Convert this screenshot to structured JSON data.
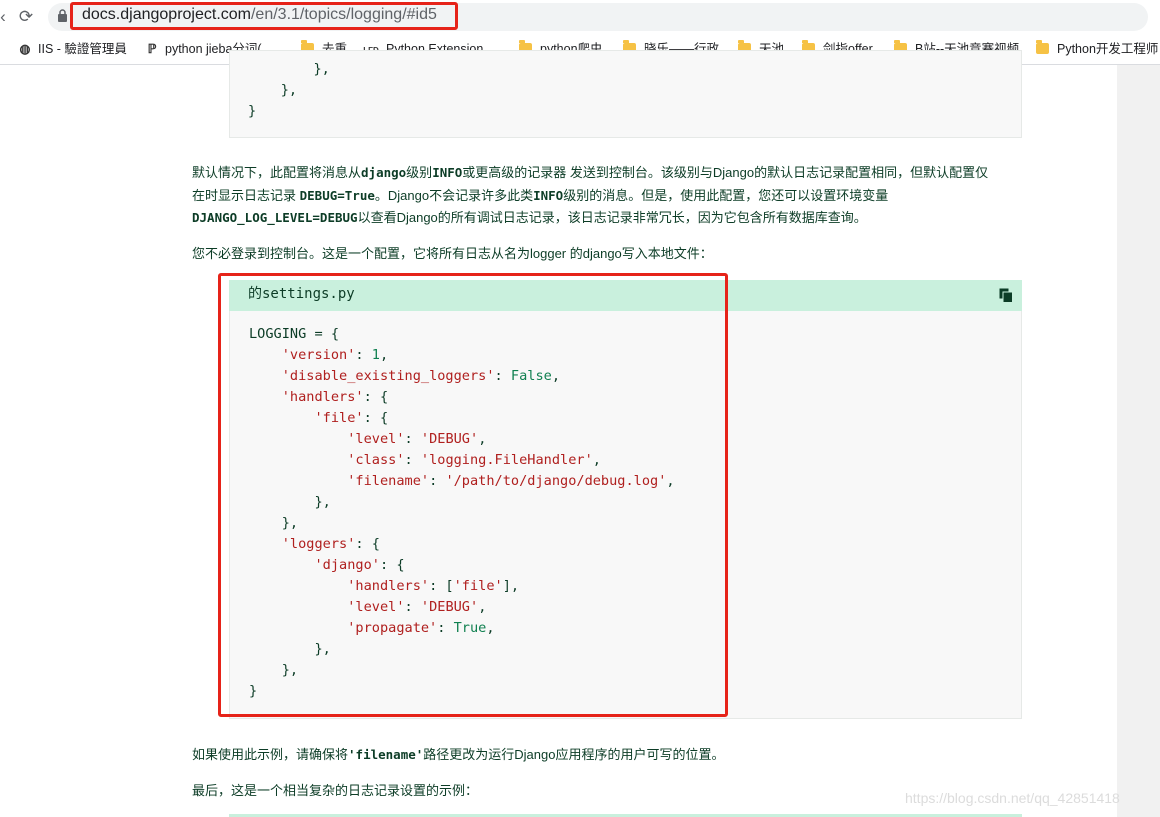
{
  "browser": {
    "url_host": "docs.djangoproject.com",
    "url_path": "/en/3.1/topics/logging/#id5",
    "bookmarks": [
      {
        "icon": "globe-icon",
        "label": "IIS - 驗證管理員"
      },
      {
        "icon": "python-icon",
        "label": "python jieba分词(..."
      },
      {
        "icon": "folder-icon",
        "label": "去重"
      },
      {
        "icon": "lfd-icon",
        "icon_text": "LFD",
        "label": "Python Extension..."
      },
      {
        "icon": "folder-icon",
        "label": "python爬虫"
      },
      {
        "icon": "folder-icon",
        "label": "晓乐——行政"
      },
      {
        "icon": "folder-icon",
        "label": "天池"
      },
      {
        "icon": "folder-icon",
        "label": "剑指offer"
      },
      {
        "icon": "folder-icon",
        "label": "B站--天池竞赛视频"
      },
      {
        "icon": "folder-icon",
        "label": "Python开发工程师"
      }
    ]
  },
  "page": {
    "prev_code_tail": "        },\n    },\n}",
    "para1_line1_a": "默认情况下，此配置将消息从",
    "para1_line1_b": "django",
    "para1_line1_c": "级别",
    "para1_line1_d": "INFO",
    "para1_line1_e": "或更高级的记录器 发送到控制台。该级别与Django的默认日志记录配置相同，但默认配置仅",
    "para1_line2_a": "在时显示日志记录 ",
    "para1_line2_b": "DEBUG=True",
    "para1_line2_c": "。Django不会记录许多此类",
    "para1_line2_d": "INFO",
    "para1_line2_e": "级别的消息。但是，使用此配置，您还可以设置环境变量",
    "para1_line3_a": "DJANGO_LOG_LEVEL=DEBUG",
    "para1_line3_b": "以查看Django的所有调试日志记录，该日志记录非常冗长，因为它包含所有数据库查询。",
    "para2": "您不必登录到控制台。这是一个配置，它将所有日志从名为logger 的django写入本地文件：",
    "file_name": "的settings.py",
    "para3_a": "如果使用此示例，请确保将",
    "para3_b": "'filename'",
    "para3_c": "路径更改为运行Django应用程序的用户可写的位置。",
    "para4": "最后，这是一个相当复杂的日志记录设置的示例：",
    "watermark": "https://blog.csdn.net/qq_42851418"
  },
  "code": {
    "lines": [
      [
        [
          "LOGGING = {",
          ""
        ]
      ],
      [
        [
          "    ",
          ""
        ],
        [
          "'version'",
          "s"
        ],
        [
          ": ",
          ""
        ],
        [
          "1",
          "n"
        ],
        [
          ",",
          ""
        ]
      ],
      [
        [
          "    ",
          ""
        ],
        [
          "'disable_existing_loggers'",
          "s"
        ],
        [
          ": ",
          ""
        ],
        [
          "False",
          "n"
        ],
        [
          ",",
          ""
        ]
      ],
      [
        [
          "    ",
          ""
        ],
        [
          "'handlers'",
          "s"
        ],
        [
          ": {",
          ""
        ]
      ],
      [
        [
          "        ",
          ""
        ],
        [
          "'file'",
          "s"
        ],
        [
          ": {",
          ""
        ]
      ],
      [
        [
          "            ",
          ""
        ],
        [
          "'level'",
          "s"
        ],
        [
          ": ",
          ""
        ],
        [
          "'DEBUG'",
          "s"
        ],
        [
          ",",
          ""
        ]
      ],
      [
        [
          "            ",
          ""
        ],
        [
          "'class'",
          "s"
        ],
        [
          ": ",
          ""
        ],
        [
          "'logging.FileHandler'",
          "s"
        ],
        [
          ",",
          ""
        ]
      ],
      [
        [
          "            ",
          ""
        ],
        [
          "'filename'",
          "s"
        ],
        [
          ": ",
          ""
        ],
        [
          "'/path/to/django/debug.log'",
          "s"
        ],
        [
          ",",
          ""
        ]
      ],
      [
        [
          "        },",
          ""
        ]
      ],
      [
        [
          "    },",
          ""
        ]
      ],
      [
        [
          "    ",
          ""
        ],
        [
          "'loggers'",
          "s"
        ],
        [
          ": {",
          ""
        ]
      ],
      [
        [
          "        ",
          ""
        ],
        [
          "'django'",
          "s"
        ],
        [
          ": {",
          ""
        ]
      ],
      [
        [
          "            ",
          ""
        ],
        [
          "'handlers'",
          "s"
        ],
        [
          ": [",
          ""
        ],
        [
          "'file'",
          "s"
        ],
        [
          "],",
          ""
        ]
      ],
      [
        [
          "            ",
          ""
        ],
        [
          "'level'",
          "s"
        ],
        [
          ": ",
          ""
        ],
        [
          "'DEBUG'",
          "s"
        ],
        [
          ",",
          ""
        ]
      ],
      [
        [
          "            ",
          ""
        ],
        [
          "'propagate'",
          "s"
        ],
        [
          ": ",
          ""
        ],
        [
          "True",
          "n"
        ],
        [
          ",",
          ""
        ]
      ],
      [
        [
          "        },",
          ""
        ]
      ],
      [
        [
          "    },",
          ""
        ]
      ],
      [
        [
          "}",
          ""
        ]
      ]
    ]
  },
  "colors": {
    "highlight_box": "#e62319",
    "code_header_bg": "#c9f0dd",
    "string": "#b0201f",
    "keyword": "#108050",
    "text": "#0c3c26"
  }
}
